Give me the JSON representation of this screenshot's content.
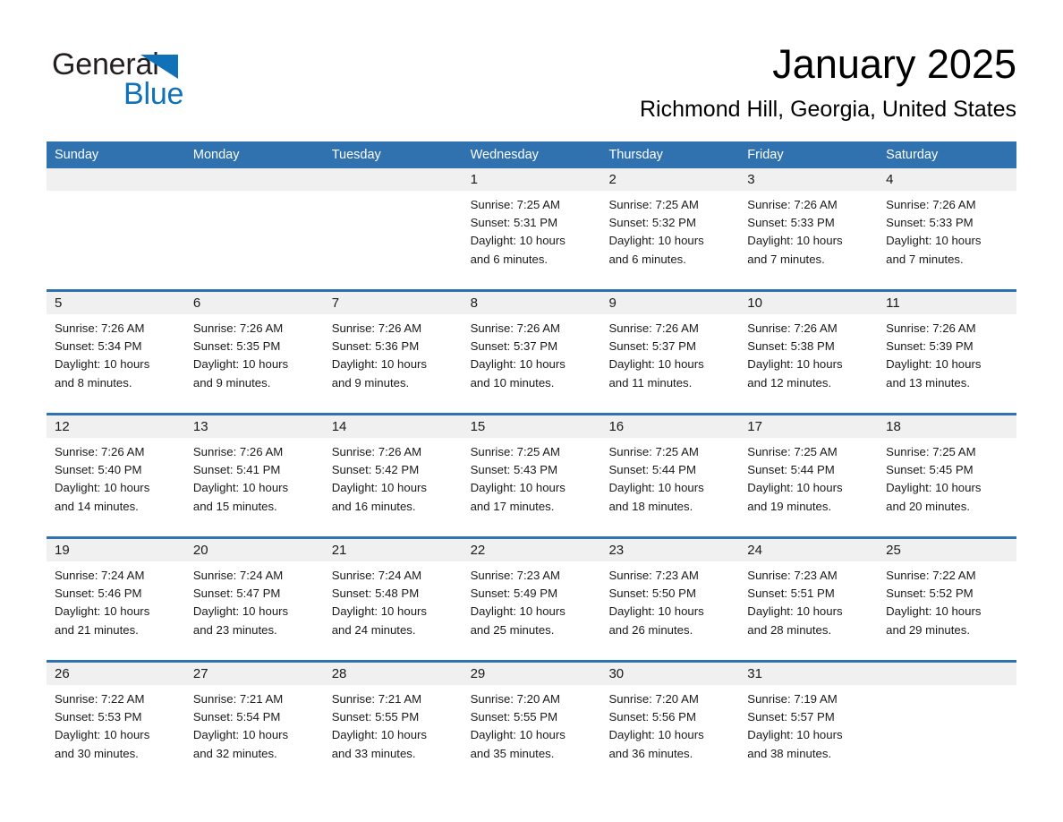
{
  "brand": {
    "line1": "General",
    "line2": "Blue",
    "mark_color": "#1071b8",
    "mark_icon": "triangle-logo-icon"
  },
  "header": {
    "title": "January 2025",
    "subtitle": "Richmond Hill, Georgia, United States"
  },
  "theme": {
    "header_blue": "#3071b0",
    "row_divider_blue": "#3071b0",
    "daynum_band_gray": "#f0f0f0",
    "page_background": "#ffffff",
    "text_color": "#1a1a1a"
  },
  "calendar": {
    "weekdays": [
      "Sunday",
      "Monday",
      "Tuesday",
      "Wednesday",
      "Thursday",
      "Friday",
      "Saturday"
    ],
    "weeks": [
      [
        {
          "day": "",
          "lines": []
        },
        {
          "day": "",
          "lines": []
        },
        {
          "day": "",
          "lines": []
        },
        {
          "day": "1",
          "lines": [
            "Sunrise: 7:25 AM",
            "Sunset: 5:31 PM",
            "Daylight: 10 hours",
            "and 6 minutes."
          ]
        },
        {
          "day": "2",
          "lines": [
            "Sunrise: 7:25 AM",
            "Sunset: 5:32 PM",
            "Daylight: 10 hours",
            "and 6 minutes."
          ]
        },
        {
          "day": "3",
          "lines": [
            "Sunrise: 7:26 AM",
            "Sunset: 5:33 PM",
            "Daylight: 10 hours",
            "and 7 minutes."
          ]
        },
        {
          "day": "4",
          "lines": [
            "Sunrise: 7:26 AM",
            "Sunset: 5:33 PM",
            "Daylight: 10 hours",
            "and 7 minutes."
          ]
        }
      ],
      [
        {
          "day": "5",
          "lines": [
            "Sunrise: 7:26 AM",
            "Sunset: 5:34 PM",
            "Daylight: 10 hours",
            "and 8 minutes."
          ]
        },
        {
          "day": "6",
          "lines": [
            "Sunrise: 7:26 AM",
            "Sunset: 5:35 PM",
            "Daylight: 10 hours",
            "and 9 minutes."
          ]
        },
        {
          "day": "7",
          "lines": [
            "Sunrise: 7:26 AM",
            "Sunset: 5:36 PM",
            "Daylight: 10 hours",
            "and 9 minutes."
          ]
        },
        {
          "day": "8",
          "lines": [
            "Sunrise: 7:26 AM",
            "Sunset: 5:37 PM",
            "Daylight: 10 hours",
            "and 10 minutes."
          ]
        },
        {
          "day": "9",
          "lines": [
            "Sunrise: 7:26 AM",
            "Sunset: 5:37 PM",
            "Daylight: 10 hours",
            "and 11 minutes."
          ]
        },
        {
          "day": "10",
          "lines": [
            "Sunrise: 7:26 AM",
            "Sunset: 5:38 PM",
            "Daylight: 10 hours",
            "and 12 minutes."
          ]
        },
        {
          "day": "11",
          "lines": [
            "Sunrise: 7:26 AM",
            "Sunset: 5:39 PM",
            "Daylight: 10 hours",
            "and 13 minutes."
          ]
        }
      ],
      [
        {
          "day": "12",
          "lines": [
            "Sunrise: 7:26 AM",
            "Sunset: 5:40 PM",
            "Daylight: 10 hours",
            "and 14 minutes."
          ]
        },
        {
          "day": "13",
          "lines": [
            "Sunrise: 7:26 AM",
            "Sunset: 5:41 PM",
            "Daylight: 10 hours",
            "and 15 minutes."
          ]
        },
        {
          "day": "14",
          "lines": [
            "Sunrise: 7:26 AM",
            "Sunset: 5:42 PM",
            "Daylight: 10 hours",
            "and 16 minutes."
          ]
        },
        {
          "day": "15",
          "lines": [
            "Sunrise: 7:25 AM",
            "Sunset: 5:43 PM",
            "Daylight: 10 hours",
            "and 17 minutes."
          ]
        },
        {
          "day": "16",
          "lines": [
            "Sunrise: 7:25 AM",
            "Sunset: 5:44 PM",
            "Daylight: 10 hours",
            "and 18 minutes."
          ]
        },
        {
          "day": "17",
          "lines": [
            "Sunrise: 7:25 AM",
            "Sunset: 5:44 PM",
            "Daylight: 10 hours",
            "and 19 minutes."
          ]
        },
        {
          "day": "18",
          "lines": [
            "Sunrise: 7:25 AM",
            "Sunset: 5:45 PM",
            "Daylight: 10 hours",
            "and 20 minutes."
          ]
        }
      ],
      [
        {
          "day": "19",
          "lines": [
            "Sunrise: 7:24 AM",
            "Sunset: 5:46 PM",
            "Daylight: 10 hours",
            "and 21 minutes."
          ]
        },
        {
          "day": "20",
          "lines": [
            "Sunrise: 7:24 AM",
            "Sunset: 5:47 PM",
            "Daylight: 10 hours",
            "and 23 minutes."
          ]
        },
        {
          "day": "21",
          "lines": [
            "Sunrise: 7:24 AM",
            "Sunset: 5:48 PM",
            "Daylight: 10 hours",
            "and 24 minutes."
          ]
        },
        {
          "day": "22",
          "lines": [
            "Sunrise: 7:23 AM",
            "Sunset: 5:49 PM",
            "Daylight: 10 hours",
            "and 25 minutes."
          ]
        },
        {
          "day": "23",
          "lines": [
            "Sunrise: 7:23 AM",
            "Sunset: 5:50 PM",
            "Daylight: 10 hours",
            "and 26 minutes."
          ]
        },
        {
          "day": "24",
          "lines": [
            "Sunrise: 7:23 AM",
            "Sunset: 5:51 PM",
            "Daylight: 10 hours",
            "and 28 minutes."
          ]
        },
        {
          "day": "25",
          "lines": [
            "Sunrise: 7:22 AM",
            "Sunset: 5:52 PM",
            "Daylight: 10 hours",
            "and 29 minutes."
          ]
        }
      ],
      [
        {
          "day": "26",
          "lines": [
            "Sunrise: 7:22 AM",
            "Sunset: 5:53 PM",
            "Daylight: 10 hours",
            "and 30 minutes."
          ]
        },
        {
          "day": "27",
          "lines": [
            "Sunrise: 7:21 AM",
            "Sunset: 5:54 PM",
            "Daylight: 10 hours",
            "and 32 minutes."
          ]
        },
        {
          "day": "28",
          "lines": [
            "Sunrise: 7:21 AM",
            "Sunset: 5:55 PM",
            "Daylight: 10 hours",
            "and 33 minutes."
          ]
        },
        {
          "day": "29",
          "lines": [
            "Sunrise: 7:20 AM",
            "Sunset: 5:55 PM",
            "Daylight: 10 hours",
            "and 35 minutes."
          ]
        },
        {
          "day": "30",
          "lines": [
            "Sunrise: 7:20 AM",
            "Sunset: 5:56 PM",
            "Daylight: 10 hours",
            "and 36 minutes."
          ]
        },
        {
          "day": "31",
          "lines": [
            "Sunrise: 7:19 AM",
            "Sunset: 5:57 PM",
            "Daylight: 10 hours",
            "and 38 minutes."
          ]
        },
        {
          "day": "",
          "lines": []
        }
      ]
    ]
  }
}
